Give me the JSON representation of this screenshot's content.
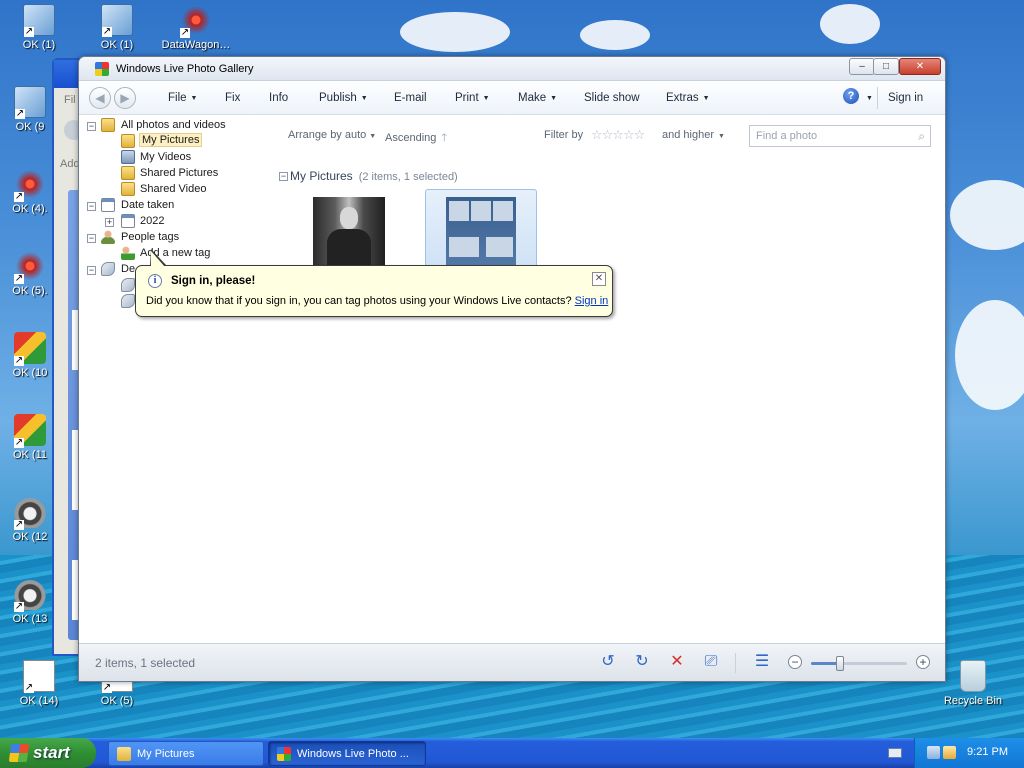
{
  "desktop": {
    "icons": [
      {
        "label": "OK (1)",
        "type": "comp"
      },
      {
        "label": "OK (1)",
        "type": "comp"
      },
      {
        "label": "DataWagon…",
        "type": "firework"
      },
      {
        "label": "OK (9",
        "type": "comp"
      },
      {
        "label": "OK (4).",
        "type": "firework"
      },
      {
        "label": "OK (5).",
        "type": "firework"
      },
      {
        "label": "OK (10",
        "type": "pencil"
      },
      {
        "label": "OK (11",
        "type": "pencil"
      },
      {
        "label": "OK (12",
        "type": "raccoon"
      },
      {
        "label": "OK (13",
        "type": "raccoon"
      },
      {
        "label": "OK (14)",
        "type": "doc"
      },
      {
        "label": "OK (5)",
        "type": "doc"
      },
      {
        "label": "Recycle Bin",
        "type": "recycle"
      }
    ],
    "background_window": {
      "menu_fragment": "Fil",
      "address_fragment": "Add"
    }
  },
  "window": {
    "title": "Windows Live Photo Gallery",
    "caption_buttons": {
      "minimize": "–",
      "maximize": "□",
      "close": "✕"
    },
    "menu": [
      "File",
      "Fix",
      "Info",
      "Publish",
      "E-mail",
      "Print",
      "Make",
      "Slide show",
      "Extras"
    ],
    "menu_has_caret": [
      true,
      false,
      false,
      true,
      false,
      true,
      true,
      false,
      true
    ],
    "help": "?",
    "sign_in": "Sign in"
  },
  "tree": {
    "all": "All photos and videos",
    "my_pictures": "My Pictures",
    "my_videos": "My Videos",
    "shared_pictures": "Shared Pictures",
    "shared_video": "Shared Video",
    "date_taken": "Date taken",
    "year": "2022",
    "people_tags": "People tags",
    "add_tag": "Add a new tag",
    "descriptive_fragment": "De"
  },
  "toolbar": {
    "arrange": "Arrange by auto",
    "order": "Ascending",
    "filter_by": "Filter by",
    "stars": "☆☆☆☆☆",
    "and_higher": "and higher",
    "search_placeholder": "Find a photo"
  },
  "group": {
    "title": "My Pictures",
    "summary": "(2 items, 1 selected)"
  },
  "balloon": {
    "title": "Sign in, please!",
    "text": "Did you know that if you sign in, you can tag photos using your Windows Live contacts?",
    "link": "Sign in"
  },
  "status": {
    "text": "2 items, 1 selected",
    "zoom_level": 0.3
  },
  "taskbar": {
    "start": "start",
    "tasks": [
      {
        "label": "My Pictures",
        "active": false
      },
      {
        "label": "Windows Live Photo ...",
        "active": true
      }
    ],
    "clock": "9:21 PM"
  },
  "colors": {
    "accent": "#245edb",
    "selection": "#fdf0c2",
    "link": "#0033cc"
  }
}
